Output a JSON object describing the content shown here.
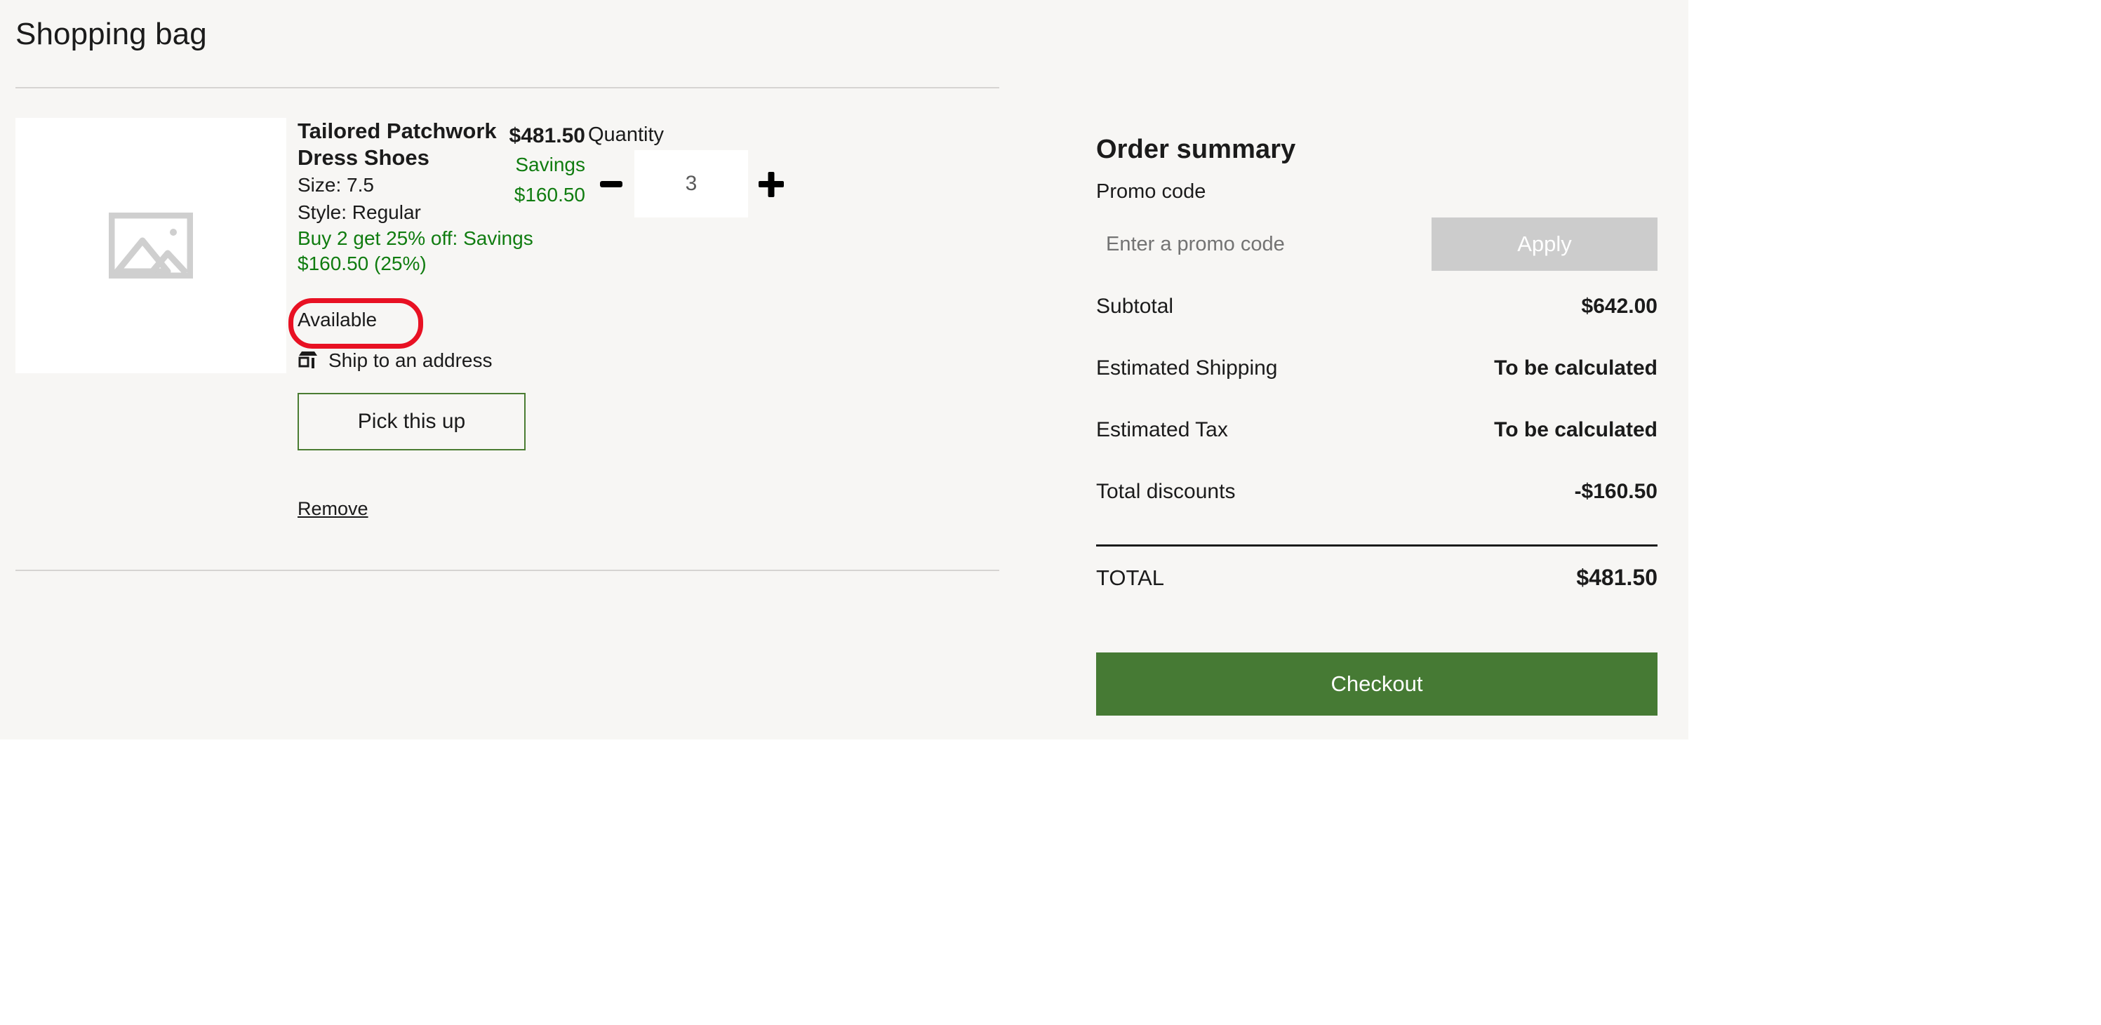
{
  "page": {
    "title": "Shopping bag",
    "accent_green": "#467a34",
    "promo_green": "#107c10",
    "annotation_red": "#e81123",
    "background": "#f7f6f4"
  },
  "line_item": {
    "image_placeholder_icon": "image-placeholder-icon",
    "title": "Tailored Patchwork Dress Shoes",
    "size": "Size: 7.5",
    "style": "Style: Regular",
    "promotion": "Buy 2 get 25% off: Savings $160.50 (25%)",
    "availability": "Available",
    "fulfillment_icon": "storefront-icon",
    "fulfillment_label": "Ship to an address",
    "pickup_button": "Pick this up",
    "remove_link": "Remove",
    "quantity": {
      "label": "Quantity",
      "value": "3",
      "decrease_icon": "minus-icon",
      "increase_icon": "plus-icon"
    },
    "price": {
      "amount": "$481.50",
      "savings_label": "Savings",
      "savings_amount": "$160.50"
    }
  },
  "order_summary": {
    "title": "Order summary",
    "promo_code_label": "Promo code",
    "promo_input_value": "",
    "promo_input_placeholder": "Enter a promo code",
    "apply_button": "Apply",
    "rows": [
      {
        "label": "Subtotal",
        "value": "$642.00"
      },
      {
        "label": "Estimated Shipping",
        "value": "To be calculated"
      },
      {
        "label": "Estimated Tax",
        "value": "To be calculated"
      },
      {
        "label": "Total discounts",
        "value": "-$160.50"
      }
    ],
    "total": {
      "label": "TOTAL",
      "value": "$481.50"
    },
    "checkout_button": "Checkout"
  },
  "annotation": {
    "highlighted_text": "Available"
  }
}
